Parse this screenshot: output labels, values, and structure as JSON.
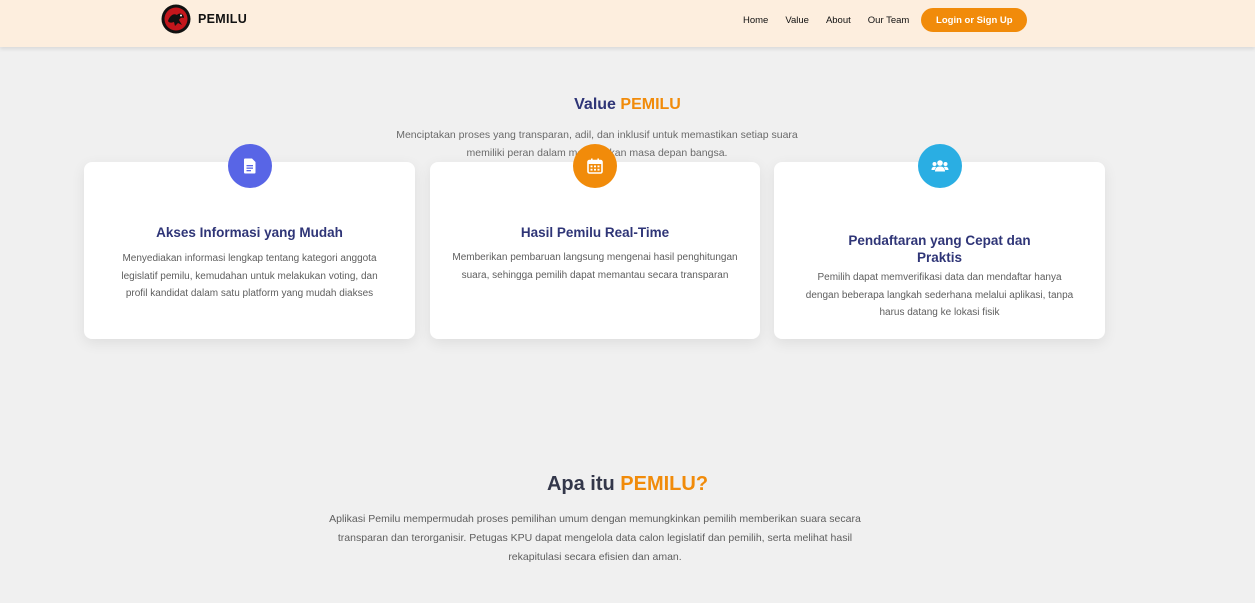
{
  "header": {
    "brand": "PEMILU",
    "nav": [
      "Home",
      "Value",
      "About",
      "Our Team"
    ],
    "login_label": "Login or Sign Up"
  },
  "value_section": {
    "title_prefix": "Value",
    "title_accent": "PEMILU",
    "description": "Menciptakan proses yang transparan, adil, dan inklusif untuk memastikan setiap suara memiliki peran dalam menentukan masa depan bangsa.",
    "cards": [
      {
        "icon": "document-icon",
        "title": "Akses Informasi yang Mudah",
        "text": "Menyediakan informasi lengkap tentang kategori anggota legislatif pemilu, kemudahan untuk melakukan voting, dan profil kandidat dalam satu platform yang mudah diakses"
      },
      {
        "icon": "calendar-icon",
        "title": "Hasil Pemilu Real-Time",
        "text": "Memberikan pembaruan langsung mengenai hasil penghitungan suara, sehingga pemilih dapat memantau secara transparan"
      },
      {
        "icon": "users-icon",
        "title": "Pendaftaran yang Cepat dan Praktis",
        "text": "Pemilih dapat memverifikasi data dan mendaftar hanya dengan beberapa langkah sederhana melalui aplikasi, tanpa harus datang ke lokasi fisik"
      }
    ]
  },
  "about_section": {
    "title_prefix": "Apa itu",
    "title_accent": "PEMILU?",
    "description": "Aplikasi Pemilu mempermudah proses pemilihan umum dengan memungkinkan pemilih memberikan suara secara transparan dan terorganisir. Petugas KPU dapat mengelola data calon legislatif dan pemilih, serta melihat hasil rekapitulasi secara efisien dan aman."
  },
  "colors": {
    "accent": "#f18b0a",
    "title": "#2f3577",
    "header_bg": "#fdeede",
    "icon_blue": "#5865e6",
    "icon_orange": "#f18b0a",
    "icon_cyan": "#2aaee3"
  }
}
